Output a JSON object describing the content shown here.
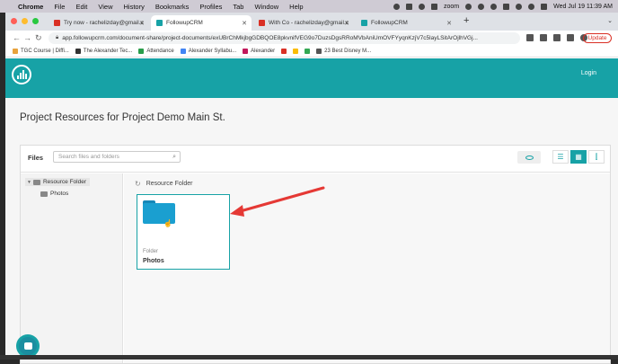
{
  "menubar": {
    "app": "Chrome",
    "items": [
      "File",
      "Edit",
      "View",
      "History",
      "Bookmarks",
      "Profiles",
      "Tab",
      "Window",
      "Help"
    ],
    "zoom": "zoom",
    "clock": "Wed Jul 19 11:39 AM"
  },
  "tabs": [
    {
      "label": "Try now - rachelizday@gmail.c",
      "color": "#d93025"
    },
    {
      "label": "FollowupCRM",
      "color": "#17a2a6"
    },
    {
      "label": "With Co - rachelizday@gmail.c",
      "color": "#d93025"
    },
    {
      "label": "FollowupCRM",
      "color": "#17a2a6"
    }
  ],
  "toolbar": {
    "url": "app.followupcrm.com/document-share/project-documents/exUBrChMkjbgGDBQOE8pkvnifVEG9o7DuzsDgsRRoMVbAniUmOVFYyqnKzjV7c5layLSitArOjlhVGj...",
    "update_label": "Update"
  },
  "bookmarks": [
    {
      "label": "TGC Course | Diffi...",
      "color": "#e8a23b"
    },
    {
      "label": "The Alexander Tec...",
      "color": "#333333"
    },
    {
      "label": "Attendance",
      "color": "#2a9d4b"
    },
    {
      "label": "Alexander Syllabu...",
      "color": "#4285f4"
    },
    {
      "label": "Alexander",
      "color": "#c2185b"
    },
    {
      "label": "",
      "color": "#d93025"
    },
    {
      "label": "",
      "color": "#fbbc04"
    },
    {
      "label": "",
      "color": "#34a853"
    },
    {
      "label": "23 Best Disney M...",
      "color": "#555555"
    }
  ],
  "header": {
    "login": "Login"
  },
  "page": {
    "title": "Project Resources for Project Demo Main St."
  },
  "files": {
    "label": "Files",
    "search_placeholder": "Search files and folders"
  },
  "tree": {
    "root": "Resource Folder",
    "child": "Photos"
  },
  "main": {
    "crumb": "Resource Folder",
    "card": {
      "type": "Folder",
      "name": "Photos"
    }
  },
  "colors": {
    "accent": "#17a2a6",
    "folder": "#1a9fd0",
    "arrow": "#e53935"
  }
}
